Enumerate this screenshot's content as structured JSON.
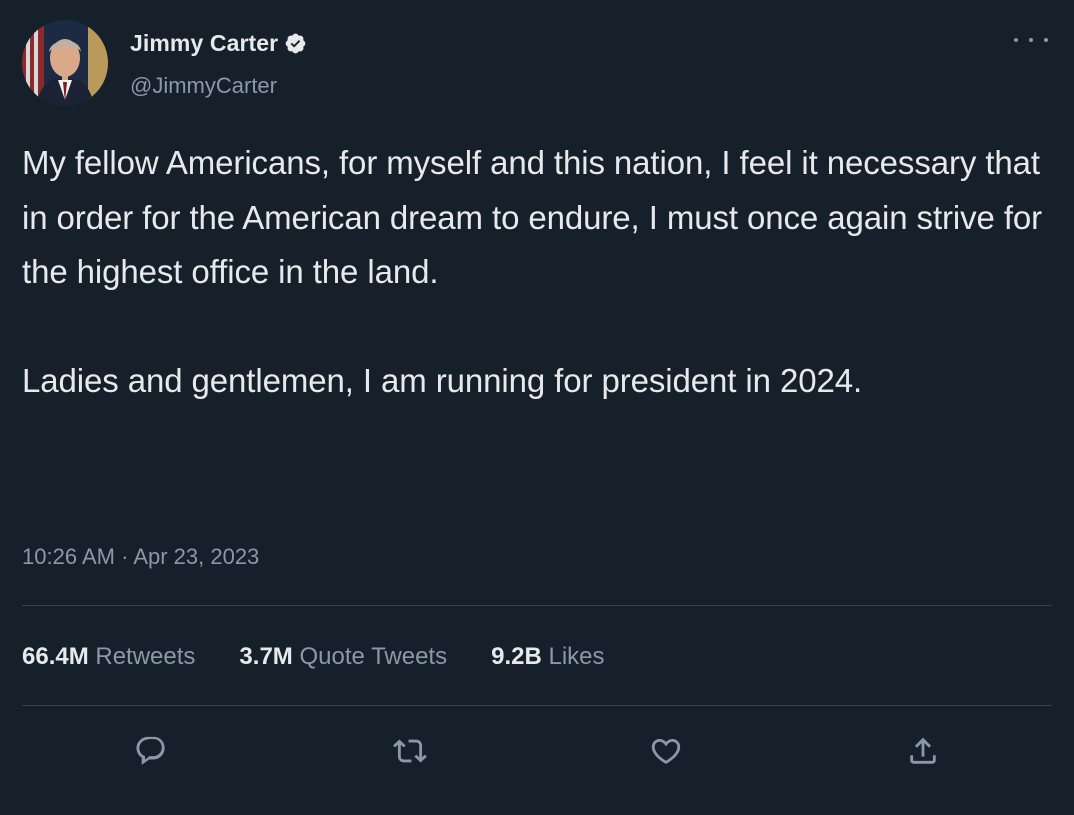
{
  "author": {
    "display_name": "Jimmy Carter",
    "handle": "@JimmyCarter",
    "verified_icon": "verified-badge-icon",
    "avatar": "profile-photo"
  },
  "menu": {
    "more_icon": "more-options-icon"
  },
  "tweet": {
    "paragraphs": [
      "My fellow Americans, for myself and this nation, I feel it necessary that in order for the American dream to endure, I must once again strive for the highest office in the land.",
      "Ladies and gentlemen, I am running for president in 2024."
    ],
    "time": "10:26 AM",
    "separator": "·",
    "date": "Apr 23, 2023"
  },
  "stats": [
    {
      "count": "66.4M",
      "label": "Retweets"
    },
    {
      "count": "3.7M",
      "label": "Quote Tweets"
    },
    {
      "count": "9.2B",
      "label": "Likes"
    }
  ],
  "actions": [
    {
      "icon": "reply-icon"
    },
    {
      "icon": "retweet-icon"
    },
    {
      "icon": "like-icon"
    },
    {
      "icon": "share-icon"
    }
  ],
  "colors": {
    "background": "#15202b",
    "primary_text": "#e7e9ea",
    "secondary_text": "#8b98a5",
    "divider": "#38444d"
  }
}
